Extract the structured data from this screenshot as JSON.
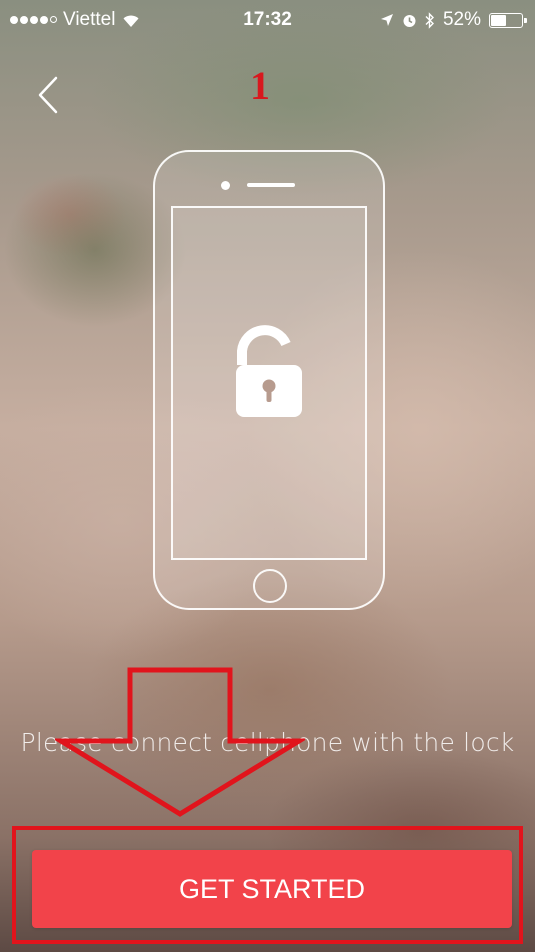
{
  "status_bar": {
    "carrier": "Viettel",
    "time": "17:32",
    "battery_percent": "52%",
    "battery_level": 0.52,
    "signal_bars": 4,
    "signal_max": 5,
    "icons": [
      "wifi-icon",
      "location-arrow-icon",
      "alarm-icon",
      "bluetooth-icon",
      "battery-icon"
    ]
  },
  "nav": {
    "back_icon": "chevron-left-icon"
  },
  "annotation": {
    "step_number": "1",
    "color": "#d8181e"
  },
  "illustration": {
    "device": "phone-icon",
    "icon": "unlocked-padlock-icon"
  },
  "instruction": "Please connect cellphone with the lock",
  "cta": {
    "label": "GET STARTED",
    "color": "#f2434a"
  },
  "highlight_color": "#e1141c"
}
